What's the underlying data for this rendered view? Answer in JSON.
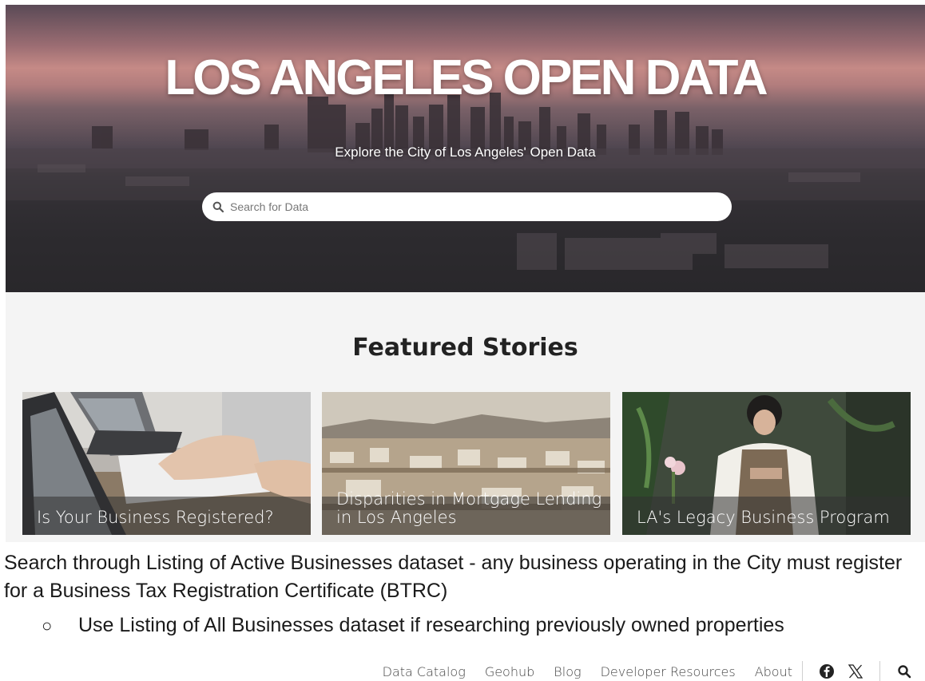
{
  "hero": {
    "title": "LOS ANGELES OPEN DATA",
    "subtitle": "Explore the City of Los Angeles' Open Data",
    "search_placeholder": "Search for Data"
  },
  "featured": {
    "title": "Featured Stories",
    "stories": [
      {
        "caption": "Is Your Business Registered?"
      },
      {
        "caption": "Disparities in Mortgage Lending in Los Angeles"
      },
      {
        "caption": "LA's Legacy Business Program"
      }
    ]
  },
  "description": {
    "main": "Search through Listing of Active Businesses dataset - any business operating in the City must register for a Business Tax Registration Certificate (BTRC)",
    "bullet_mark": "○",
    "bullet": "Use Listing of All Businesses dataset if researching previously owned properties"
  },
  "footer": {
    "links": [
      "Data Catalog",
      "Geohub",
      "Blog",
      "Developer Resources",
      "About"
    ],
    "icons": [
      "facebook-icon",
      "x-icon",
      "search-icon"
    ]
  },
  "colors": {
    "featured_bg": "#f4f4f4",
    "caption_band": "#323232"
  }
}
